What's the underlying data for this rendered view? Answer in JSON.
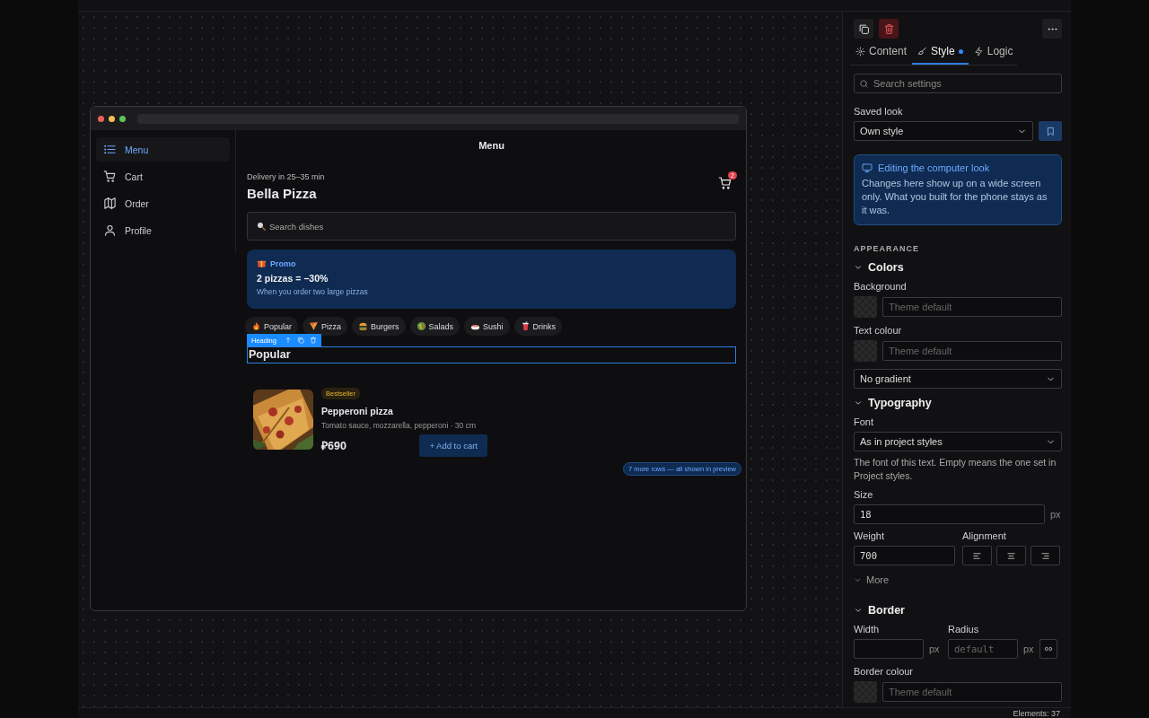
{
  "preview": {
    "nav": [
      {
        "label": "Menu",
        "kind": "list",
        "selected": true
      },
      {
        "label": "Cart",
        "kind": "cart",
        "selected": false
      },
      {
        "label": "Order",
        "kind": "map",
        "selected": false
      },
      {
        "label": "Profile",
        "kind": "person",
        "selected": false
      }
    ],
    "header_title": "Menu",
    "delivery": "Delivery in 25–35 min",
    "restaurant": "Bella Pizza",
    "cart_badge": "2",
    "search": {
      "placeholder": "Search dishes"
    },
    "promo": {
      "label": "Promo",
      "title": "2 pizzas = −30%",
      "subtitle": "When you order two large pizzas"
    },
    "categories": [
      {
        "label": "Popular",
        "kind": "fire"
      },
      {
        "label": "Pizza",
        "kind": "pizza"
      },
      {
        "label": "Burgers",
        "kind": "burger"
      },
      {
        "label": "Salads",
        "kind": "salad"
      },
      {
        "label": "Sushi",
        "kind": "sushi"
      },
      {
        "label": "Drinks",
        "kind": "drink"
      }
    ],
    "selection_toolbar": {
      "label": "Heading"
    },
    "heading": "Popular",
    "items": [
      {
        "badge": "Bestseller",
        "name": "Pepperoni pizza",
        "description": "Tomato sauce, mozzarella, pepperoni · 30 cm",
        "price": "₽690",
        "button": "+ Add to cart"
      }
    ],
    "more_rows": "7 more rows — all shown in preview"
  },
  "panel": {
    "tabs": [
      {
        "label": "Content",
        "kind": "gear",
        "selected": false,
        "changed": false
      },
      {
        "label": "Style",
        "kind": "brush",
        "selected": true,
        "changed": true
      },
      {
        "label": "Logic",
        "kind": "bolt",
        "selected": false,
        "changed": false
      }
    ],
    "search": {
      "placeholder": "Search settings"
    },
    "saved_look": {
      "label": "Saved look",
      "value": "Own style"
    },
    "info": {
      "title": "Editing the computer look",
      "text": "Changes here show up on a wide screen only. What you built for the phone stays as it was."
    },
    "section": "APPEARANCE",
    "colors": {
      "title": "Colors",
      "expanded": true,
      "background": {
        "label": "Background",
        "placeholder": "Theme default"
      },
      "text_colour": {
        "label": "Text colour",
        "placeholder": "Theme default"
      },
      "gradient": "No gradient"
    },
    "typography": {
      "title": "Typography",
      "expanded": true,
      "font_label": "Font",
      "font": "As in project styles",
      "font_help": "The font of this text. Empty means the one set in Project styles.",
      "size_label": "Size",
      "size": "18",
      "size_unit": "px",
      "weight_label": "Weight",
      "weight": "700",
      "alignment_label": "Alignment",
      "more": "More"
    },
    "border": {
      "title": "Border",
      "expanded": true,
      "width_label": "Width",
      "width_unit": "px",
      "radius_label": "Radius",
      "radius_placeholder": "default",
      "radius_unit": "px",
      "colour_label": "Border colour",
      "colour_placeholder": "Theme default"
    }
  },
  "status_bar": {
    "text": "Elements: 37"
  }
}
